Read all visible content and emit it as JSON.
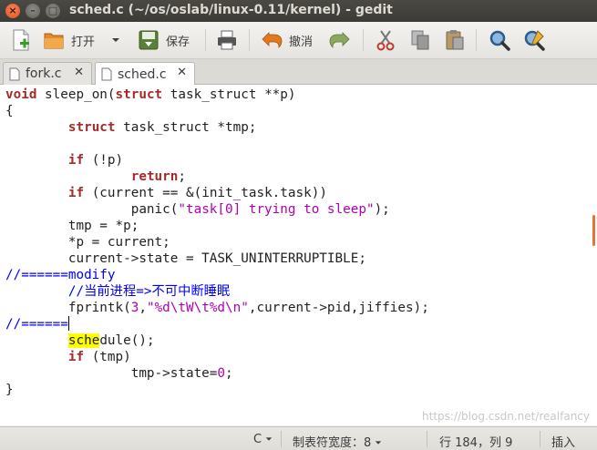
{
  "window": {
    "title": "sched.c (~/os/oslab/linux-0.11/kernel) - gedit",
    "controls": [
      "×",
      "–",
      "□"
    ]
  },
  "toolbar": {
    "open_label": "打开",
    "save_label": "保存",
    "undo_label": "撤消"
  },
  "tabs": [
    {
      "label": "fork.c"
    },
    {
      "label": "sched.c"
    }
  ],
  "code": {
    "l1": [
      "void",
      " sleep_on(",
      "struct",
      " task_struct **p)"
    ],
    "l2": "{",
    "l3": [
      "        ",
      "struct",
      " task_struct *tmp;"
    ],
    "l4": "",
    "l5": [
      "        ",
      "if",
      " (!p)"
    ],
    "l6": [
      "                ",
      "return",
      ";"
    ],
    "l7": [
      "        ",
      "if",
      " (current == &(init_task.task))"
    ],
    "l8": [
      "                panic(",
      "\"task[0] trying to sleep\"",
      ");"
    ],
    "l9": "        tmp = *p;",
    "l10": "        *p = current;",
    "l11": "        current->state = TASK_UNINTERRUPTIBLE;",
    "l12": "//======modify",
    "l13": [
      "        ",
      "//当前进程=>不可中断睡眠"
    ],
    "l14": [
      "        fprintk(",
      "3",
      ",",
      "\"%d\\tW\\t%d\\n\"",
      ",current->pid,jiffies);"
    ],
    "l15": "//======",
    "l16": [
      "        ",
      "sche",
      "dule();"
    ],
    "l17": [
      "        ",
      "if",
      " (tmp)"
    ],
    "l18": [
      "                tmp->state=",
      "0",
      ";"
    ],
    "l19": "}"
  },
  "statusbar": {
    "language": "C",
    "tab_width": "制表符宽度：8",
    "position": "行 184，列 9",
    "mode": "插入"
  },
  "watermark": "https://blog.csdn.net/realfancy",
  "colors": {
    "keyword": "#a52a2a",
    "string": "#b000b0",
    "comment": "#0000ff",
    "highlight": "#ffff00",
    "titlebar": "#3c3b37"
  },
  "icons": [
    "new-document-icon",
    "open-folder-icon",
    "save-icon",
    "print-icon",
    "undo-icon",
    "redo-icon",
    "cut-icon",
    "copy-icon",
    "paste-icon",
    "find-icon",
    "replace-icon",
    "file-icon"
  ]
}
